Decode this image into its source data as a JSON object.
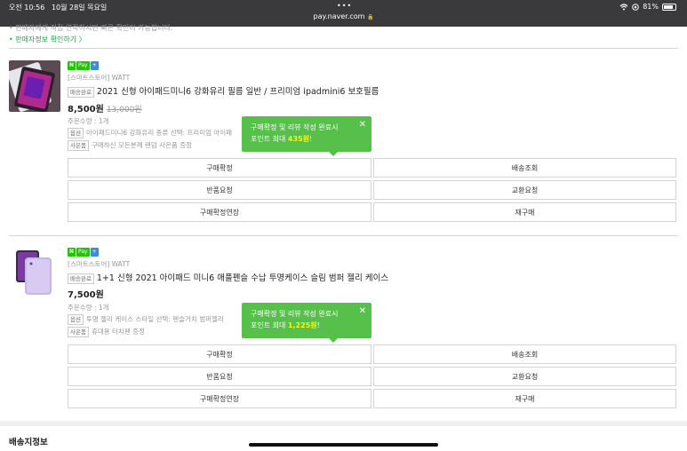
{
  "status_bar": {
    "time": "오전 10:56",
    "date": "10월 28일 목요일",
    "dots": "•••",
    "url": "pay.naver.com",
    "battery": "81%"
  },
  "notice": {
    "text": "• 판매자에게 직접 연락하시면 빠른 확인이 가능합니다.",
    "link": "• 판매자정보 확인하기 〉"
  },
  "badges": {
    "n": "N",
    "pay": "Pay",
    "plus": "+"
  },
  "products": [
    {
      "store": "[스마트스토어] WATT",
      "status_tag": "배송완료",
      "title": "2021 신형 아이패드미니6 강화유리 필름 일반 / 프리미엄 ipadmini6 보호필름",
      "price": "8,500원",
      "orig_price": "13,000원",
      "qty": "주문수량 : 1개",
      "option_tag": "옵션",
      "option": "아이패드미니6 강화유리 종류 선택: 프리미엄 아이패",
      "gift_tag": "사은품",
      "gift": "구매하신 모든분께 랜덤 사은품 증정",
      "tooltip_line1": "구매확정 및 리뷰 작성 완료시",
      "tooltip_prefix": "포인트 최대",
      "tooltip_points": "435원",
      "tooltip_suffix": "!",
      "buttons": [
        "구매확정",
        "배송조회",
        "반품요청",
        "교환요청",
        "구매확정연장",
        "재구매"
      ]
    },
    {
      "store": "[스마트스토어] WATT",
      "status_tag": "배송완료",
      "title": "1+1 신형 2021 아이패드 미니6 애플펜슬 수납 투명케이스 슬림 범퍼 젤리 케이스",
      "price": "7,500원",
      "orig_price": "",
      "qty": "주문수량 : 1개",
      "option_tag": "옵션",
      "option": "투명 젤리 케이스 스타일 선택: 펜슬거치 범퍼젤리",
      "gift_tag": "사은품",
      "gift": "휴대용 터치펜 증정",
      "tooltip_line1": "구매확정 및 리뷰 작성 완료시",
      "tooltip_prefix": "포인트 최대",
      "tooltip_points": "1,225원",
      "tooltip_suffix": "!",
      "buttons": [
        "구매확정",
        "배송조회",
        "반품요청",
        "교환요청",
        "구매확정연장",
        "재구매"
      ]
    }
  ],
  "section": {
    "title": "배송지정보"
  },
  "icons": {
    "close": "✕",
    "wifi": "wifi-icon",
    "lock": "🔒"
  },
  "colors": {
    "accent": "#1ec800",
    "tooltip": "#56c04a",
    "highlight": "#fff600"
  }
}
